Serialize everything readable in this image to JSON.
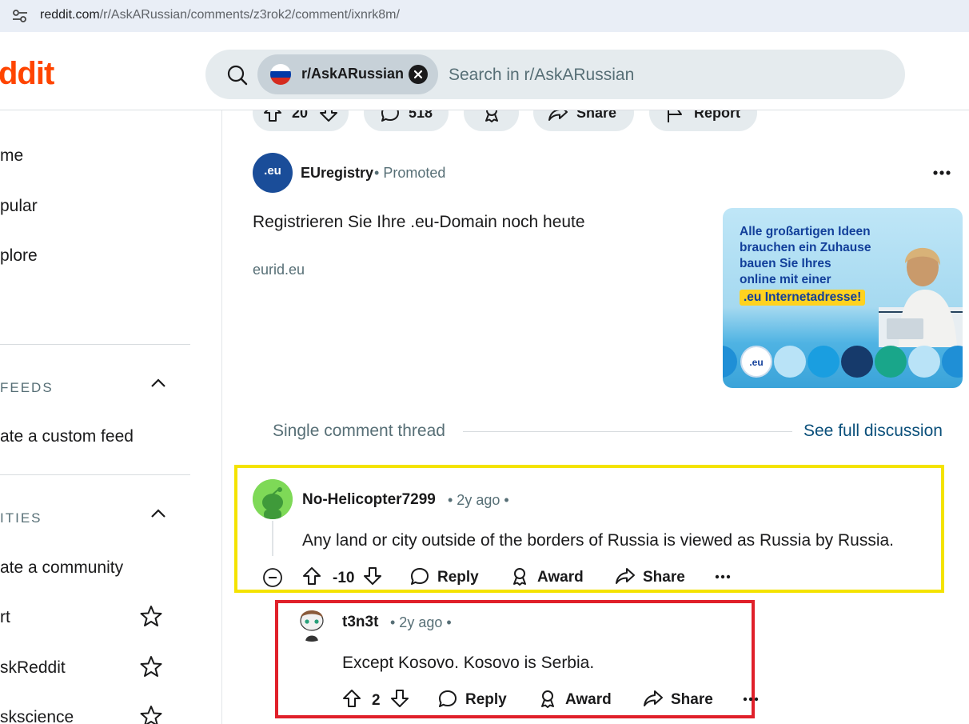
{
  "browser": {
    "url_host": "reddit.com",
    "url_path": "/r/AskARussian/comments/z3rok2/comment/ixnrk8m/"
  },
  "header": {
    "logo_text": "ddit",
    "search_chip": "r/AskARussian",
    "search_placeholder": "Search in r/AskARussian"
  },
  "sidebar": {
    "nav": [
      "me",
      "pular",
      "plore"
    ],
    "feeds_title": "FEEDS",
    "create_feed": "ate a custom feed",
    "communities_title": "ITIES",
    "create_community": "ate a community",
    "communities": [
      "rt",
      "skReddit",
      "skscience"
    ]
  },
  "post_actions": {
    "votes": "20",
    "comments": "518",
    "share": "Share",
    "report": "Report"
  },
  "ad": {
    "avatar_text": ".eu",
    "advertiser": "EUregistry",
    "label": "Promoted",
    "headline": "Registrieren Sie Ihre .eu-Domain noch heute",
    "domain": "eurid.eu",
    "image_line1": "Alle großartigen Ideen",
    "image_line2": "brauchen ein Zuhause",
    "image_line3": "bauen Sie Ihres",
    "image_line4": "online mit einer",
    "image_highlight": ".eu Internetadresse!",
    "image_badge": ".eu"
  },
  "thread": {
    "label": "Single comment thread",
    "see_full": "See full discussion"
  },
  "comments": [
    {
      "author": "No-Helicopter7299",
      "meta": "• 2y ago •",
      "body": "Any land or city outside of the borders of Russia is viewed as Russia by Russia.",
      "score": "-10",
      "reply": "Reply",
      "award": "Award",
      "share": "Share"
    },
    {
      "author": "t3n3t",
      "meta": "• 2y ago •",
      "body": "Except Kosovo. Kosovo is Serbia.",
      "score": "2",
      "reply": "Reply",
      "award": "Award",
      "share": "Share"
    }
  ],
  "colors": {
    "brand": "#ff4500",
    "highlight_yellow": "#f4e300",
    "highlight_red": "#e0202a"
  }
}
